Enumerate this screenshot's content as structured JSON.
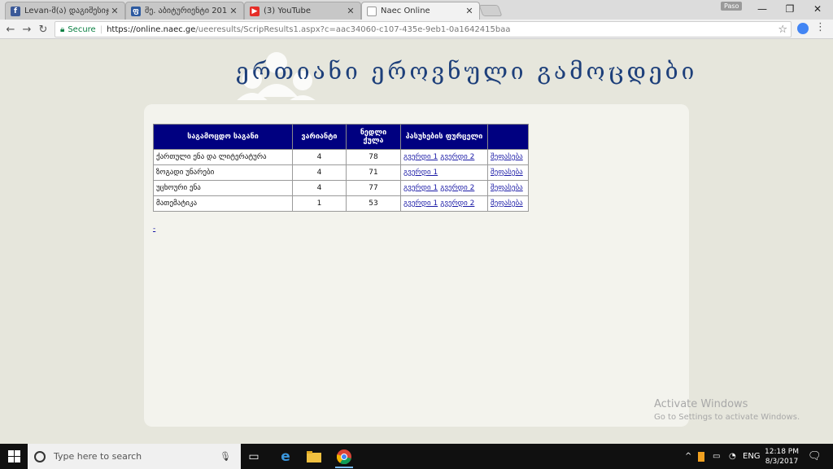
{
  "browser": {
    "tabs": [
      {
        "title": "Levan-მ(ა) დაგიმესიჯ",
        "icon": "facebook-icon"
      },
      {
        "title": "მე. აბიტურიენტი 201",
        "icon": "site-icon"
      },
      {
        "title": "(3) YouTube",
        "icon": "youtube-icon"
      },
      {
        "title": "Naec Online",
        "icon": "page-icon",
        "active": true
      }
    ],
    "profile": "Paso",
    "secure_label": "Secure",
    "url_base": "https://online.naec.ge",
    "url_rest": "/ueeresults/ScripResults1.aspx?c=aac34060-c107-435e-9eb1-0a1642415baa"
  },
  "page": {
    "title": "ერთიანი ეროვნული გამოცდები",
    "table": {
      "headers": [
        "საგამოცდო საგანი",
        "ვარიანტი",
        "ნედლი ქულა",
        "პასუხების ფურცელი",
        ""
      ],
      "rows": [
        {
          "subject": "ქართული ენა და ლიტერატურა",
          "variant": "4",
          "score": "78",
          "page1": "გვერდი 1",
          "page2": "გვერდი 2",
          "action": "შეფასება"
        },
        {
          "subject": "ზოგადი უნარები",
          "variant": "4",
          "score": "71",
          "page1": "გვერდი 1",
          "page2": "",
          "action": "შეფასება"
        },
        {
          "subject": "უცხოური ენა",
          "variant": "4",
          "score": "77",
          "page1": "გვერდი 1",
          "page2": "გვერდი 2",
          "action": "შეფასება"
        },
        {
          "subject": "მათემატიკა",
          "variant": "1",
          "score": "53",
          "page1": "გვერდი 1",
          "page2": "გვერდი 2",
          "action": "შეფასება"
        }
      ]
    },
    "bottom_link": "-"
  },
  "watermark": {
    "line1": "Activate Windows",
    "line2": "Go to Settings to activate Windows."
  },
  "taskbar": {
    "search_placeholder": "Type here to search",
    "language": "ENG",
    "time": "12:18 PM",
    "date": "8/3/2017"
  }
}
